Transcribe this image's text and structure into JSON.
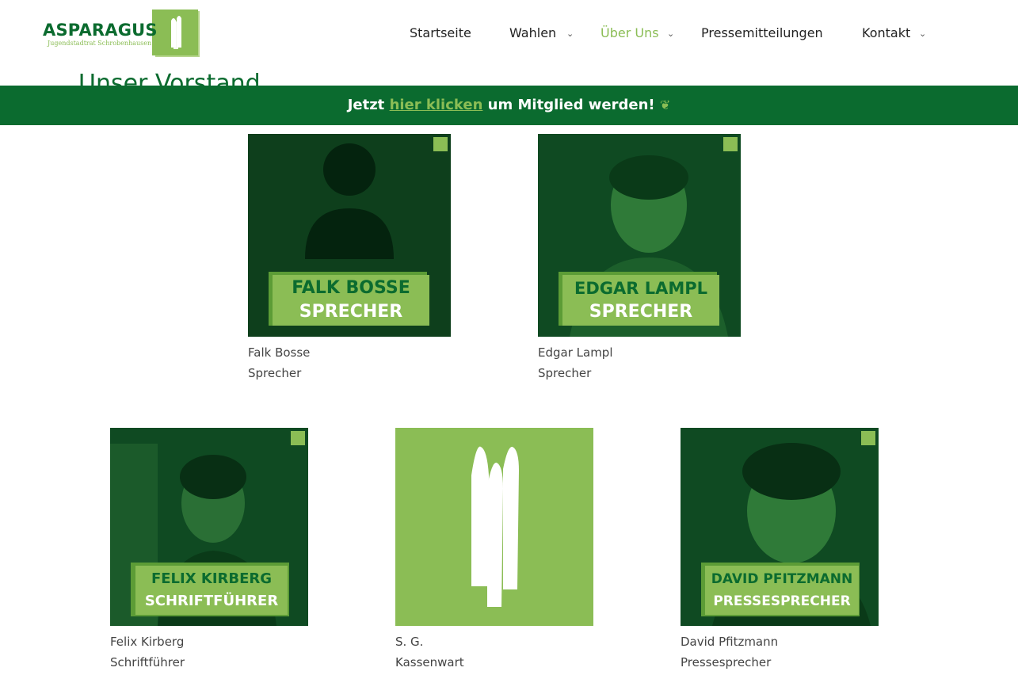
{
  "brand": {
    "name": "ASPARAGUS",
    "subtitle": "Jugendstadtrat Schrobenhausen"
  },
  "nav": [
    {
      "label": "Startseite"
    },
    {
      "label": "Wahlen"
    },
    {
      "label": "Über Uns"
    },
    {
      "label": "Pressemitteilungen"
    },
    {
      "label": "Kontakt"
    }
  ],
  "page_title_partial": "Unser Vorstand",
  "banner": {
    "prefix": "Jetzt",
    "link": "hier klicken",
    "suffix": "um Mitglied werden!"
  },
  "members": [
    {
      "name": "Falk Bosse",
      "role": "Sprecher",
      "plate_name": "FALK BOSSE",
      "plate_role": "SPRECHER"
    },
    {
      "name": "Edgar Lampl",
      "role": "Sprecher",
      "plate_name": "EDGAR LAMPL",
      "plate_role": "SPRECHER"
    },
    {
      "name": "Felix Kirberg",
      "role": "Schriftführer",
      "plate_name": "FELIX KIRBERG",
      "plate_role": "SCHRIFTFÜHRER"
    },
    {
      "name": "S. G.",
      "role": "Kassenwart"
    },
    {
      "name": "David Pfitzmann",
      "role": "Pressesprecher",
      "plate_name": "DAVID PFITZMANN",
      "plate_role": "PRESSESPRECHER"
    }
  ],
  "colors": {
    "brand_dark": "#0b6b2f",
    "brand_light": "#8bbd55"
  }
}
